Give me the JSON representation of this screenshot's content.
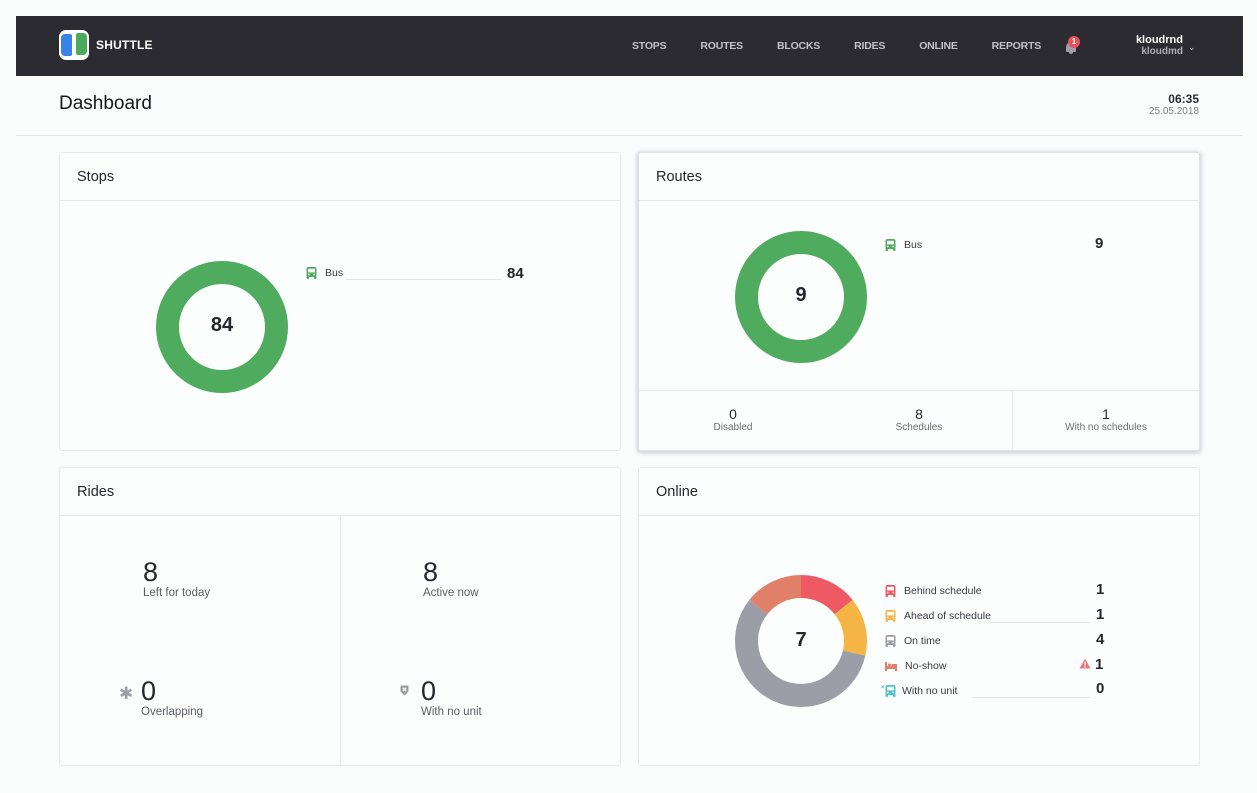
{
  "app": {
    "brand": "SHUTTLE"
  },
  "nav": {
    "items": [
      {
        "label": "STOPS"
      },
      {
        "label": "ROUTES"
      },
      {
        "label": "BLOCKS"
      },
      {
        "label": "RIDES"
      },
      {
        "label": "ONLINE"
      },
      {
        "label": "REPORTS"
      }
    ],
    "notifications_count": "1",
    "user_name": "kloudrnd",
    "user_login": "kloudmd"
  },
  "header": {
    "title": "Dashboard",
    "time": "06:35",
    "date": "25.05.2018"
  },
  "colors": {
    "green": "#4fab5d",
    "red": "#ef5963",
    "yellow": "#f5b544",
    "gray": "#9b9ea7",
    "salmon": "#e08068",
    "teal": "#4fc4c8"
  },
  "stops": {
    "title": "Stops",
    "total": "84",
    "legend": [
      {
        "label": "Bus",
        "value": "84",
        "icon": "bus-icon"
      }
    ]
  },
  "routes": {
    "title": "Routes",
    "total": "9",
    "legend": [
      {
        "label": "Bus",
        "value": "9",
        "icon": "bus-icon"
      }
    ],
    "stats": [
      {
        "value": "0",
        "label": "Disabled"
      },
      {
        "value": "8",
        "label": "Schedules"
      },
      {
        "value": "1",
        "label": "With no schedules"
      }
    ]
  },
  "rides": {
    "title": "Rides",
    "stats": [
      {
        "value": "8",
        "label": "Left for today"
      },
      {
        "value": "8",
        "label": "Active now"
      },
      {
        "value": "0",
        "label": "Overlapping",
        "icon": "asterisk-icon"
      },
      {
        "value": "0",
        "label": "With no unit",
        "icon": "shield-x-icon"
      }
    ]
  },
  "online": {
    "title": "Online",
    "total": "7",
    "legend": [
      {
        "label": "Behind schedule",
        "value": "1",
        "icon": "bus-icon",
        "color": "#ef5963"
      },
      {
        "label": "Ahead of schedule",
        "value": "1",
        "icon": "bus-icon",
        "color": "#f5b544"
      },
      {
        "label": "On time",
        "value": "4",
        "icon": "bus-icon",
        "color": "#9b9ea7"
      },
      {
        "label": "No-show",
        "value": "1",
        "icon": "bed-icon",
        "color": "#e08068",
        "warning": true
      },
      {
        "label": "With no unit",
        "value": "0",
        "icon": "bus-x-icon",
        "color": "#4fc4c8"
      }
    ]
  },
  "chart_data": [
    {
      "type": "pie",
      "title": "Stops",
      "categories": [
        "Bus"
      ],
      "values": [
        84
      ],
      "center_label": "84"
    },
    {
      "type": "pie",
      "title": "Routes",
      "categories": [
        "Bus"
      ],
      "values": [
        9
      ],
      "center_label": "9"
    },
    {
      "type": "pie",
      "title": "Online",
      "categories": [
        "Behind schedule",
        "Ahead of schedule",
        "On time",
        "No-show",
        "With no unit"
      ],
      "values": [
        1,
        1,
        4,
        1,
        0
      ],
      "colors": [
        "#ef5963",
        "#f5b544",
        "#9b9ea7",
        "#e08068",
        "#4fc4c8"
      ],
      "center_label": "7"
    }
  ]
}
